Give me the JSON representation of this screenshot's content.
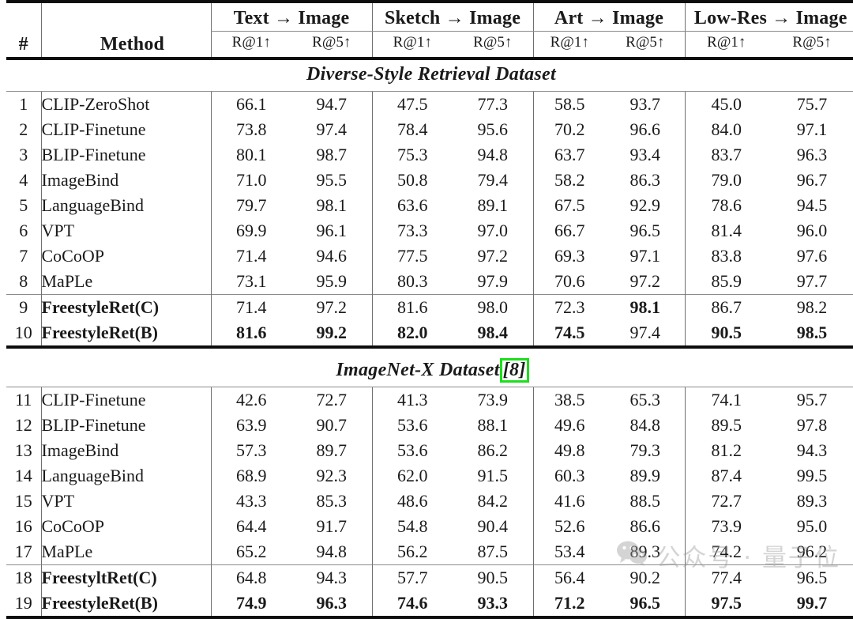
{
  "table": {
    "columns": {
      "index_header": "#",
      "method_header": "Method",
      "groups": [
        {
          "label": "Text → Image",
          "sub": [
            "R@1↑",
            "R@5↑"
          ]
        },
        {
          "label": "Sketch → Image",
          "sub": [
            "R@1↑",
            "R@5↑"
          ]
        },
        {
          "label": "Art → Image",
          "sub": [
            "R@1↑",
            "R@5↑"
          ]
        },
        {
          "label": "Low-Res → Image",
          "sub": [
            "R@1↑",
            "R@5↑"
          ]
        }
      ]
    },
    "sections": [
      {
        "title": "Diverse-Style Retrieval Dataset",
        "citation": "",
        "rows": [
          {
            "num": "1",
            "method": "CLIP-ZeroShot",
            "method_bold": false,
            "values": [
              "66.1",
              "94.7",
              "47.5",
              "77.3",
              "58.5",
              "93.7",
              "45.0",
              "75.7"
            ],
            "bold": [
              false,
              false,
              false,
              false,
              false,
              false,
              false,
              false
            ]
          },
          {
            "num": "2",
            "method": "CLIP-Finetune",
            "method_bold": false,
            "values": [
              "73.8",
              "97.4",
              "78.4",
              "95.6",
              "70.2",
              "96.6",
              "84.0",
              "97.1"
            ],
            "bold": [
              false,
              false,
              false,
              false,
              false,
              false,
              false,
              false
            ]
          },
          {
            "num": "3",
            "method": "BLIP-Finetune",
            "method_bold": false,
            "values": [
              "80.1",
              "98.7",
              "75.3",
              "94.8",
              "63.7",
              "93.4",
              "83.7",
              "96.3"
            ],
            "bold": [
              false,
              false,
              false,
              false,
              false,
              false,
              false,
              false
            ]
          },
          {
            "num": "4",
            "method": "ImageBind",
            "method_bold": false,
            "values": [
              "71.0",
              "95.5",
              "50.8",
              "79.4",
              "58.2",
              "86.3",
              "79.0",
              "96.7"
            ],
            "bold": [
              false,
              false,
              false,
              false,
              false,
              false,
              false,
              false
            ]
          },
          {
            "num": "5",
            "method": "LanguageBind",
            "method_bold": false,
            "values": [
              "79.7",
              "98.1",
              "63.6",
              "89.1",
              "67.5",
              "92.9",
              "78.6",
              "94.5"
            ],
            "bold": [
              false,
              false,
              false,
              false,
              false,
              false,
              false,
              false
            ]
          },
          {
            "num": "6",
            "method": "VPT",
            "method_bold": false,
            "values": [
              "69.9",
              "96.1",
              "73.3",
              "97.0",
              "66.7",
              "96.5",
              "81.4",
              "96.0"
            ],
            "bold": [
              false,
              false,
              false,
              false,
              false,
              false,
              false,
              false
            ]
          },
          {
            "num": "7",
            "method": "CoCoOP",
            "method_bold": false,
            "values": [
              "71.4",
              "94.6",
              "77.5",
              "97.2",
              "69.3",
              "97.1",
              "83.8",
              "97.6"
            ],
            "bold": [
              false,
              false,
              false,
              false,
              false,
              false,
              false,
              false
            ]
          },
          {
            "num": "8",
            "method": "MaPLe",
            "method_bold": false,
            "values": [
              "73.1",
              "95.9",
              "80.3",
              "97.9",
              "70.6",
              "97.2",
              "85.9",
              "97.7"
            ],
            "bold": [
              false,
              false,
              false,
              false,
              false,
              false,
              false,
              false
            ]
          }
        ],
        "highlight_rows": [
          {
            "num": "9",
            "method": "FreestyleRet(C)",
            "method_bold": true,
            "values": [
              "71.4",
              "97.2",
              "81.6",
              "98.0",
              "72.3",
              "98.1",
              "86.7",
              "98.2"
            ],
            "bold": [
              false,
              false,
              false,
              false,
              false,
              true,
              false,
              false
            ]
          },
          {
            "num": "10",
            "method": "FreestyleRet(B)",
            "method_bold": true,
            "values": [
              "81.6",
              "99.2",
              "82.0",
              "98.4",
              "74.5",
              "97.4",
              "90.5",
              "98.5"
            ],
            "bold": [
              true,
              true,
              true,
              true,
              true,
              false,
              true,
              true
            ]
          }
        ]
      },
      {
        "title": "ImageNet-X Dataset",
        "citation": "[8]",
        "rows": [
          {
            "num": "11",
            "method": "CLIP-Finetune",
            "method_bold": false,
            "values": [
              "42.6",
              "72.7",
              "41.3",
              "73.9",
              "38.5",
              "65.3",
              "74.1",
              "95.7"
            ],
            "bold": [
              false,
              false,
              false,
              false,
              false,
              false,
              false,
              false
            ]
          },
          {
            "num": "12",
            "method": "BLIP-Finetune",
            "method_bold": false,
            "values": [
              "63.9",
              "90.7",
              "53.6",
              "88.1",
              "49.6",
              "84.8",
              "89.5",
              "97.8"
            ],
            "bold": [
              false,
              false,
              false,
              false,
              false,
              false,
              false,
              false
            ]
          },
          {
            "num": "13",
            "method": "ImageBind",
            "method_bold": false,
            "values": [
              "57.3",
              "89.7",
              "53.6",
              "86.2",
              "49.8",
              "79.3",
              "81.2",
              "94.3"
            ],
            "bold": [
              false,
              false,
              false,
              false,
              false,
              false,
              false,
              false
            ]
          },
          {
            "num": "14",
            "method": "LanguageBind",
            "method_bold": false,
            "values": [
              "68.9",
              "92.3",
              "62.0",
              "91.5",
              "60.3",
              "89.9",
              "87.4",
              "99.5"
            ],
            "bold": [
              false,
              false,
              false,
              false,
              false,
              false,
              false,
              false
            ]
          },
          {
            "num": "15",
            "method": "VPT",
            "method_bold": false,
            "values": [
              "43.3",
              "85.3",
              "48.6",
              "84.2",
              "41.6",
              "88.5",
              "72.7",
              "89.3"
            ],
            "bold": [
              false,
              false,
              false,
              false,
              false,
              false,
              false,
              false
            ]
          },
          {
            "num": "16",
            "method": "CoCoOP",
            "method_bold": false,
            "values": [
              "64.4",
              "91.7",
              "54.8",
              "90.4",
              "52.6",
              "86.6",
              "73.9",
              "95.0"
            ],
            "bold": [
              false,
              false,
              false,
              false,
              false,
              false,
              false,
              false
            ]
          },
          {
            "num": "17",
            "method": "MaPLe",
            "method_bold": false,
            "values": [
              "65.2",
              "94.8",
              "56.2",
              "87.5",
              "53.4",
              "89.3",
              "74.2",
              "96.2"
            ],
            "bold": [
              false,
              false,
              false,
              false,
              false,
              false,
              false,
              false
            ]
          }
        ],
        "highlight_rows": [
          {
            "num": "18",
            "method": "FreestyltRet(C)",
            "method_bold": true,
            "values": [
              "64.8",
              "94.3",
              "57.7",
              "90.5",
              "56.4",
              "90.2",
              "77.4",
              "96.5"
            ],
            "bold": [
              false,
              false,
              false,
              false,
              false,
              false,
              false,
              false
            ]
          },
          {
            "num": "19",
            "method": "FreestyleRet(B)",
            "method_bold": true,
            "values": [
              "74.9",
              "96.3",
              "74.6",
              "93.3",
              "71.2",
              "96.5",
              "97.5",
              "99.7"
            ],
            "bold": [
              true,
              true,
              true,
              true,
              true,
              true,
              true,
              true
            ]
          }
        ]
      }
    ]
  },
  "watermark": {
    "text": "公众号 · 量子位",
    "icon": "wechat-icon",
    "color": "#9b9b9b"
  },
  "highlight": {
    "citation_box_color": "#1ae01a"
  }
}
